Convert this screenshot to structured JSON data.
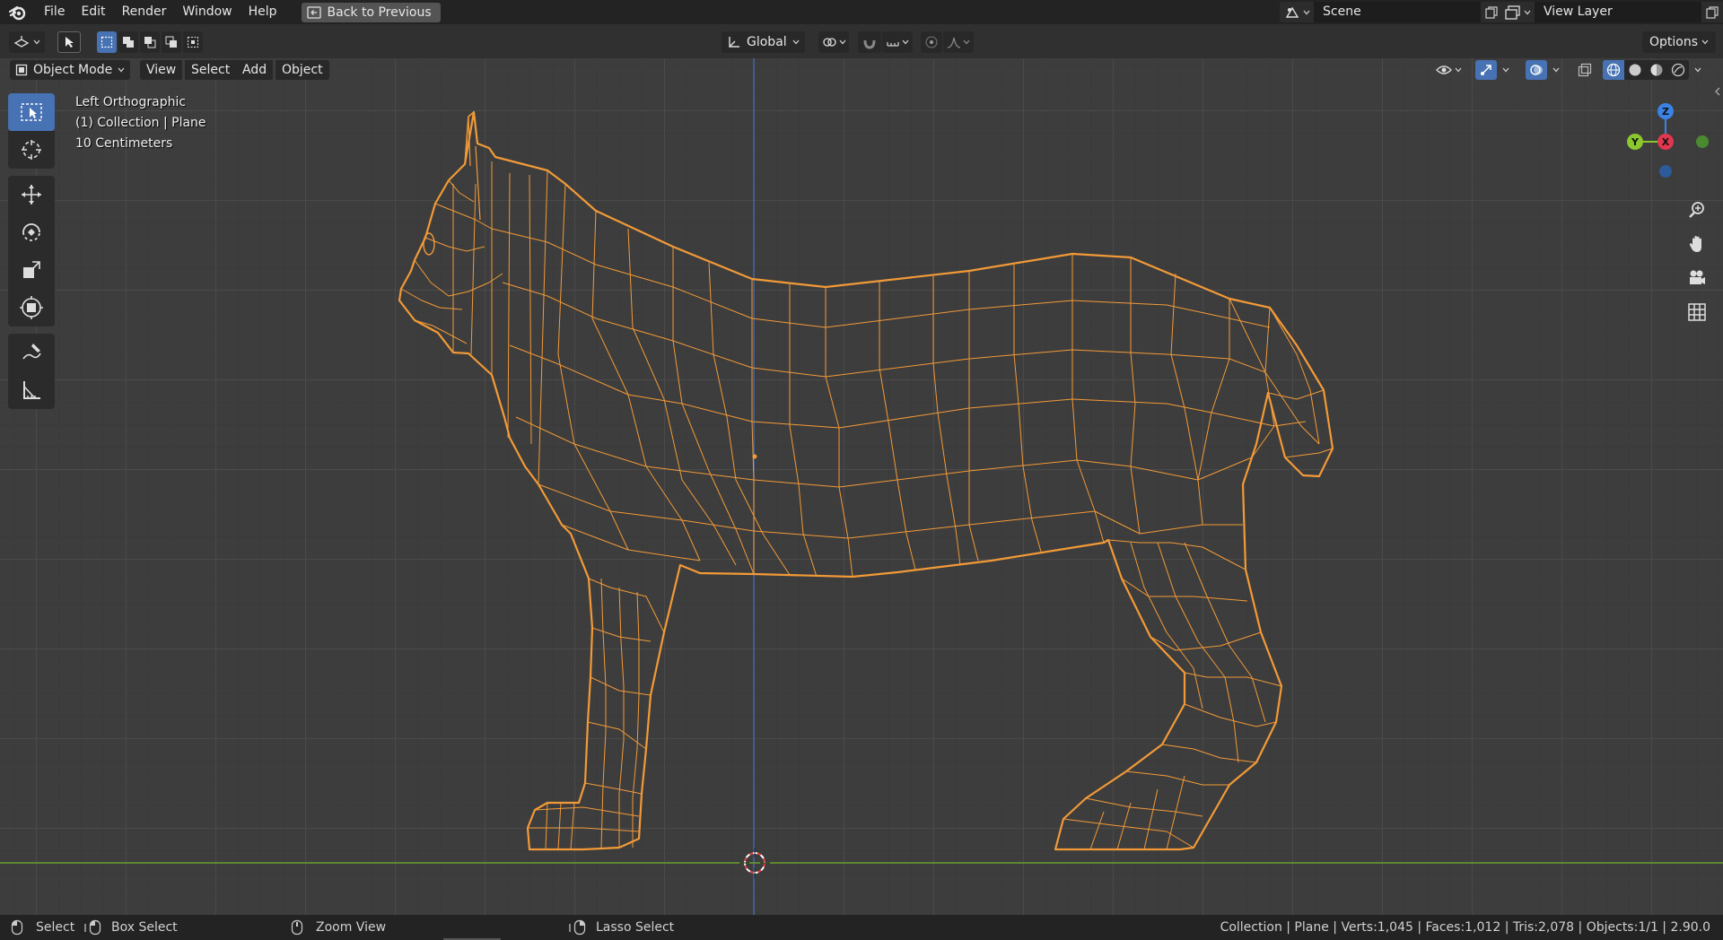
{
  "menubar": {
    "items": [
      "File",
      "Edit",
      "Render",
      "Window",
      "Help"
    ],
    "back_button": "Back to Previous",
    "scene": "Scene",
    "view_layer": "View Layer"
  },
  "header": {
    "transform_orientation": "Global",
    "options_label": "Options"
  },
  "viewport_header": {
    "mode": "Object Mode",
    "menus": [
      "View",
      "Select",
      "Add",
      "Object"
    ]
  },
  "overlay": {
    "view_name": "Left Orthographic",
    "collection_info": "(1) Collection | Plane",
    "scale_info": "10 Centimeters"
  },
  "gizmo": {
    "z_label": "Z",
    "y_label": "Y",
    "x_label": "X"
  },
  "toolbar": {
    "tools": [
      "select-box",
      "cursor",
      "move",
      "rotate",
      "scale",
      "transform",
      "annotate",
      "measure"
    ]
  },
  "statusbar": {
    "select": "Select",
    "box_select": "Box Select",
    "zoom_view": "Zoom View",
    "lasso_select": "Lasso Select",
    "stats": "Collection | Plane | Verts:1,045 | Faces:1,012 | Tris:2,078 | Objects:1/1 | 2.90.0"
  },
  "colors": {
    "accent": "#4772b3",
    "wire": "#f29a38",
    "x_axis": "#e0374f",
    "y_axis": "#8ac82e",
    "z_axis": "#3b82e6"
  }
}
